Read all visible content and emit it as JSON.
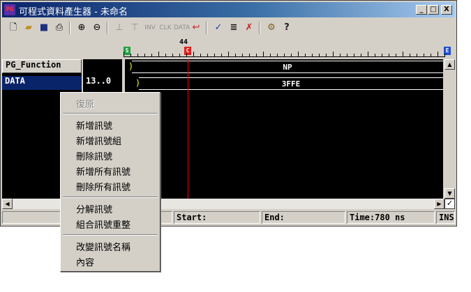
{
  "window": {
    "title": "可程式資料產生器 - 未命名",
    "app_icon_text": "PG",
    "controls": [
      "_",
      "□",
      "X"
    ]
  },
  "toolbar": {
    "icons": [
      "new-file-icon",
      "open-folder-icon",
      "save-icon",
      "print-icon",
      "zoom-in-icon",
      "zoom-out-icon",
      "high-pulse-icon",
      "low-pulse-icon",
      "invert-icon",
      "clock-icon",
      "data-icon",
      "undo-curve-icon",
      "check-icon",
      "list-icon",
      "clear-icon",
      "settings-icon",
      "help-icon"
    ],
    "disabled_labels": {
      "inv": "INV",
      "clk": "CLK",
      "data": "DATA"
    }
  },
  "ruler": {
    "cursor_value": "44",
    "start_marker": "S",
    "cursor_marker": "C",
    "end_marker": "E",
    "cursor_color": "#ff0000"
  },
  "signals": {
    "header": {
      "name": "PG_Function",
      "bits": "",
      "value": "NP"
    },
    "rows": [
      {
        "name": "DATA",
        "bits": "13..0",
        "value": "3FFE"
      }
    ]
  },
  "status": {
    "start_label": "Start:",
    "end_label": "End:",
    "time": "Time:780 ns",
    "mode": "INS"
  },
  "context_menu": {
    "items": [
      {
        "label": "復原",
        "disabled": true
      },
      {
        "label": "新增訊號",
        "disabled": false
      },
      {
        "label": "新增訊號組",
        "disabled": false
      },
      {
        "label": "刪除訊號",
        "disabled": false
      },
      {
        "label": "新增所有訊號",
        "disabled": false
      },
      {
        "label": "刪除所有訊號",
        "disabled": false
      },
      {
        "label": "分解訊號",
        "disabled": false
      },
      {
        "label": "組合訊號重整",
        "disabled": false
      },
      {
        "label": "改變訊號名稱",
        "disabled": false
      },
      {
        "label": "內容",
        "disabled": false
      }
    ]
  }
}
